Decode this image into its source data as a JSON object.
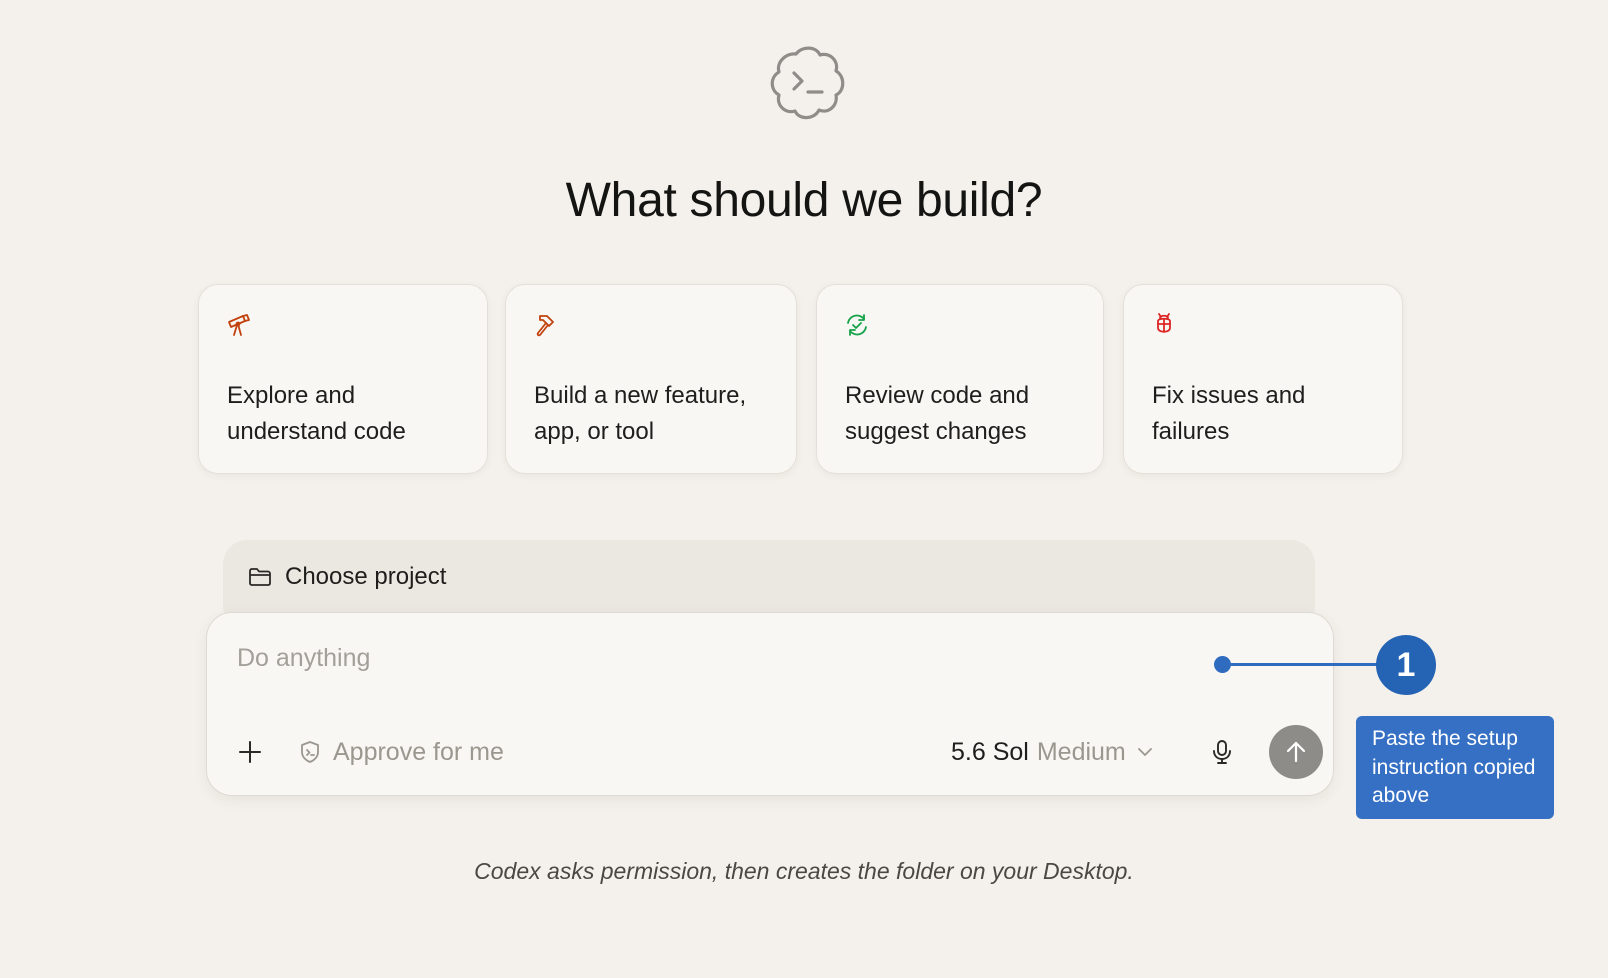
{
  "logo": {
    "icon": "terminal-cloud-icon"
  },
  "headline": "What should we build?",
  "cards": [
    {
      "icon": "telescope-icon",
      "label": "Explore and understand code",
      "color": "#c2410c"
    },
    {
      "icon": "hammer-icon",
      "label": "Build a new feature, app, or tool",
      "color": "#c2410c"
    },
    {
      "icon": "refresh-check-icon",
      "label": "Review code and suggest changes",
      "color": "#16a34a"
    },
    {
      "icon": "bug-icon",
      "label": "Fix issues and failures",
      "color": "#dc2626"
    }
  ],
  "project": {
    "label": "Choose project",
    "icon": "folder-icon"
  },
  "composer": {
    "placeholder": "Do anything",
    "approve_label": "Approve for me",
    "model_name": "5.6 Sol",
    "model_effort": "Medium"
  },
  "callout": {
    "number": "1",
    "text": "Paste the setup instruction copied above",
    "color": "#2f6bbf"
  },
  "footer_note": "Codex asks permission, then creates the folder on your Desktop."
}
